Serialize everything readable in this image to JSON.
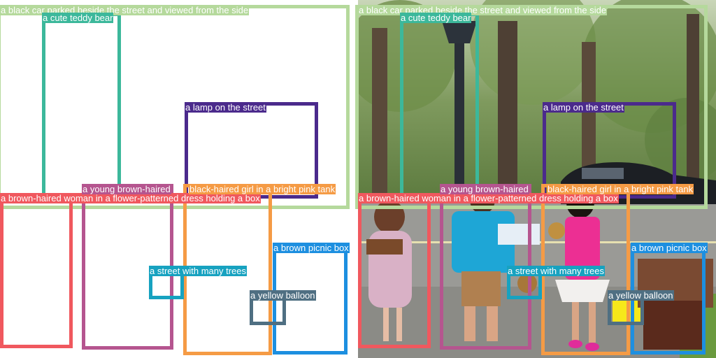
{
  "annotations": [
    {
      "key": "car",
      "label": "a black car parked beside the street and viewed from the side",
      "color": "#b5d99c"
    },
    {
      "key": "teddy",
      "label": "a cute teddy bear",
      "color": "#3cb89b"
    },
    {
      "key": "lamp",
      "label": "a lamp on the street",
      "color": "#4b2a8c"
    },
    {
      "key": "boy",
      "label": "a young brown-haired",
      "color": "#b5558f"
    },
    {
      "key": "girl",
      "label": "black-haired girl in a bright pink tank",
      "color": "#f59b45"
    },
    {
      "key": "woman",
      "label": "a brown-haired woman in a flower-patterned dress holding a box",
      "color": "#f0585e"
    },
    {
      "key": "picnic",
      "label": "a brown picnic box",
      "color": "#1d8fe0"
    },
    {
      "key": "street",
      "label": "a street with many trees",
      "color": "#17a2c0"
    },
    {
      "key": "balloon",
      "label": "a yellow balloon",
      "color": "#4f6f82"
    }
  ]
}
